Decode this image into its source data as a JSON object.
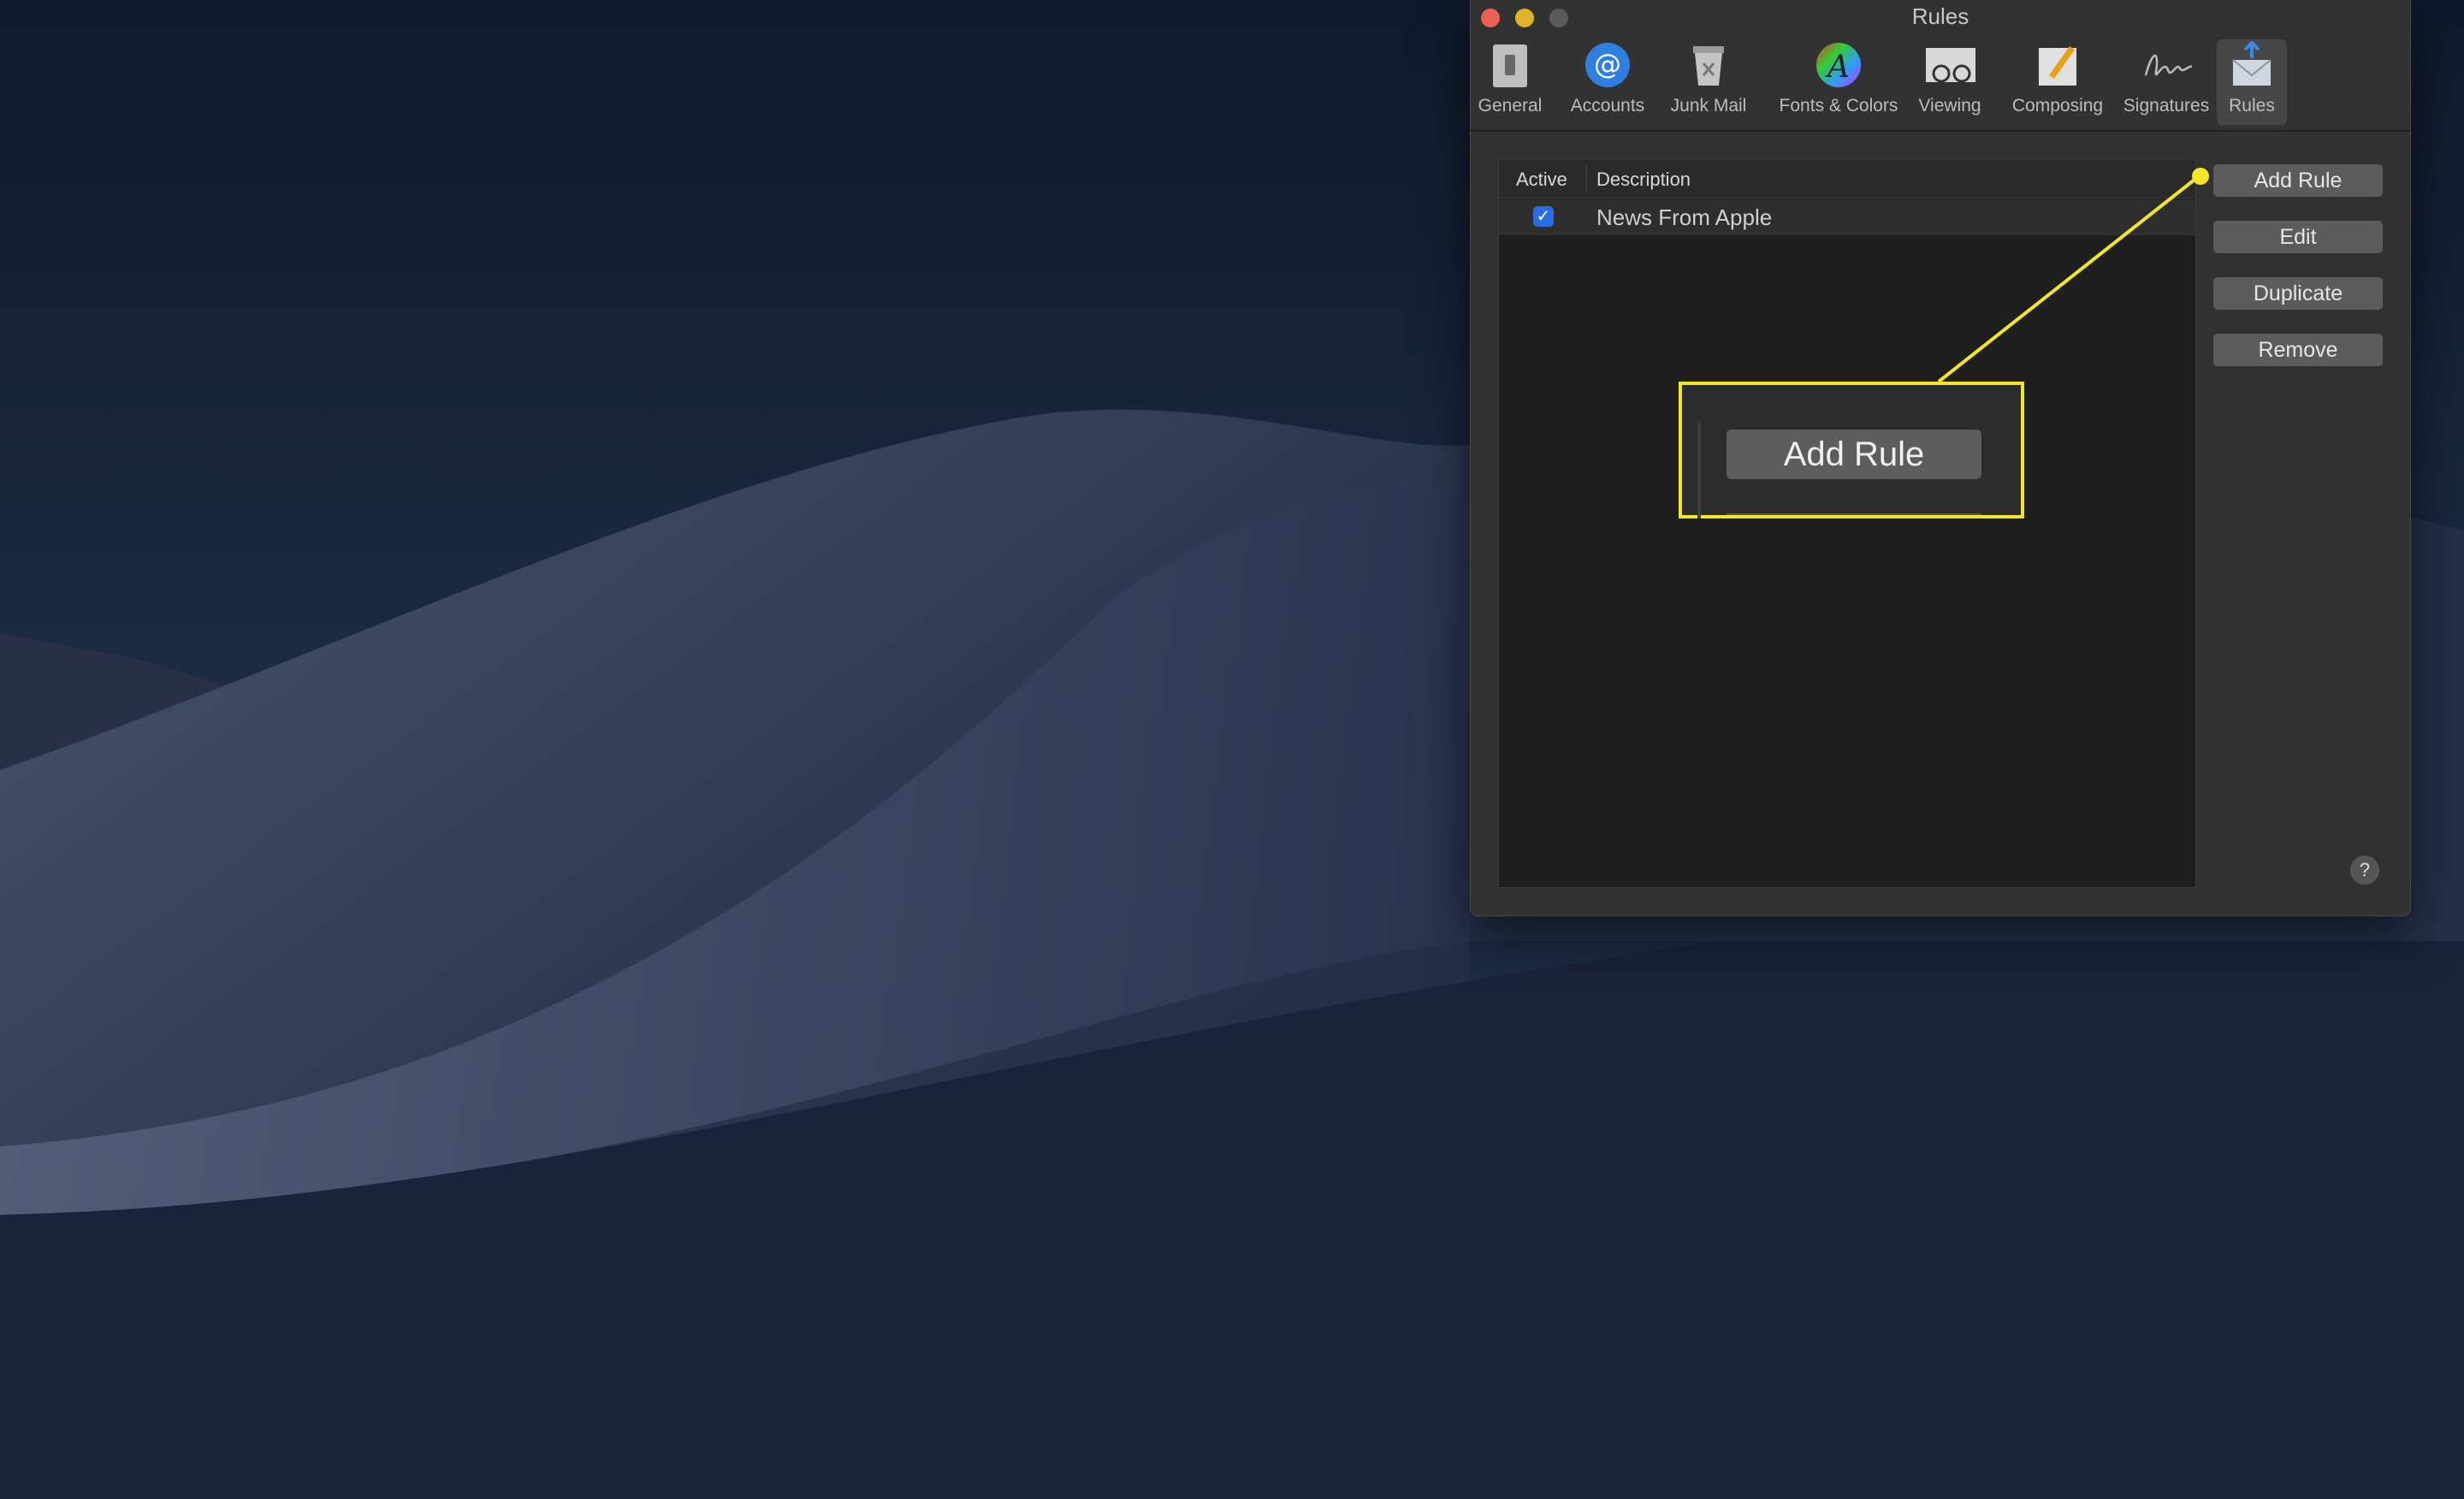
{
  "window": {
    "title": "Rules"
  },
  "toolbar": {
    "items": [
      {
        "label": "General",
        "icon": "general-switch-icon"
      },
      {
        "label": "Accounts",
        "icon": "at-sign-icon"
      },
      {
        "label": "Junk Mail",
        "icon": "junk-mail-trash-icon"
      },
      {
        "label": "Fonts & Colors",
        "icon": "fonts-colors-wheel-icon"
      },
      {
        "label": "Viewing",
        "icon": "viewing-glasses-icon"
      },
      {
        "label": "Composing",
        "icon": "composing-pencil-icon"
      },
      {
        "label": "Signatures",
        "icon": "signature-icon"
      },
      {
        "label": "Rules",
        "icon": "rules-envelope-icon"
      }
    ],
    "selected": "Rules"
  },
  "rules_list": {
    "columns": [
      "Active",
      "Description"
    ],
    "rows": [
      {
        "active": true,
        "description": "News From Apple"
      }
    ]
  },
  "buttons": {
    "add": "Add Rule",
    "edit": "Edit",
    "duplicate": "Duplicate",
    "remove": "Remove",
    "help": "?"
  },
  "callout": {
    "label": "Add Rule",
    "color": "#f2e626"
  }
}
